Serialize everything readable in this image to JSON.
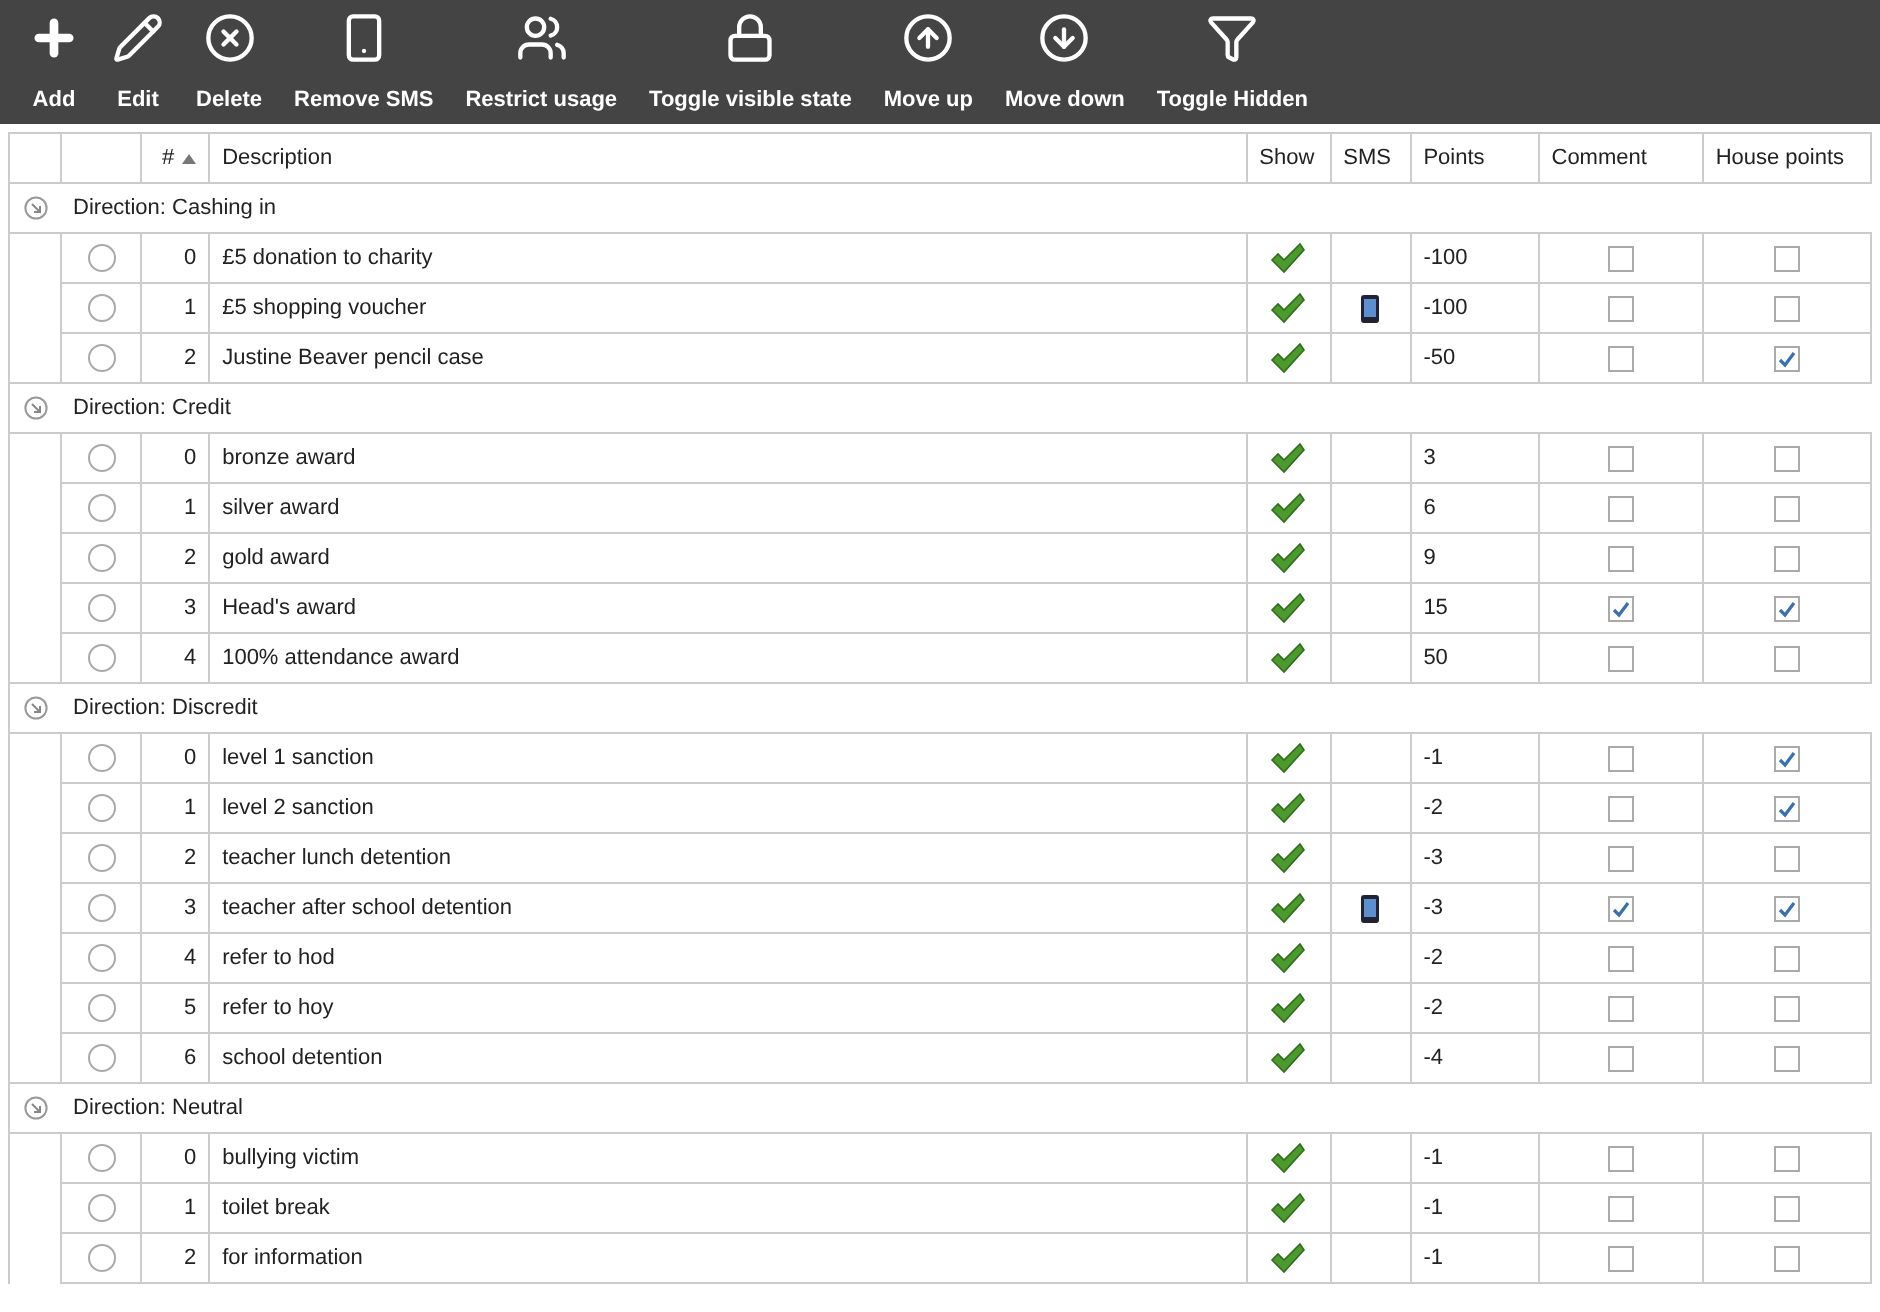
{
  "toolbar": [
    {
      "kind": "add",
      "label": "Add"
    },
    {
      "kind": "edit",
      "label": "Edit"
    },
    {
      "kind": "delete",
      "label": "Delete"
    },
    {
      "kind": "phone",
      "label": "Remove SMS"
    },
    {
      "kind": "users",
      "label": "Restrict usage"
    },
    {
      "kind": "lock",
      "label": "Toggle visible state"
    },
    {
      "kind": "up",
      "label": "Move up"
    },
    {
      "kind": "down",
      "label": "Move down"
    },
    {
      "kind": "funnel",
      "label": "Toggle Hidden"
    }
  ],
  "columns": [
    {
      "label": "#",
      "sorted": true,
      "ascending": true
    },
    {
      "label": "Description"
    },
    {
      "label": "Show"
    },
    {
      "label": "SMS"
    },
    {
      "label": "Points"
    },
    {
      "label": "Comment"
    },
    {
      "label": "House points"
    }
  ],
  "groups": [
    {
      "label": "Direction: Cashing in",
      "rows": [
        {
          "number": "0",
          "description": "£5 donation to charity",
          "selected": false,
          "show": true,
          "sms": false,
          "points": "-100",
          "comment": false,
          "house_points": false
        },
        {
          "number": "1",
          "description": "£5 shopping voucher",
          "selected": false,
          "show": true,
          "sms": true,
          "points": "-100",
          "comment": false,
          "house_points": false
        },
        {
          "number": "2",
          "description": "Justine Beaver pencil case",
          "selected": false,
          "show": true,
          "sms": false,
          "points": "-50",
          "comment": false,
          "house_points": true
        }
      ]
    },
    {
      "label": "Direction: Credit",
      "rows": [
        {
          "number": "0",
          "description": "bronze award",
          "selected": false,
          "show": true,
          "sms": false,
          "points": "3",
          "comment": false,
          "house_points": false
        },
        {
          "number": "1",
          "description": "silver award",
          "selected": false,
          "show": true,
          "sms": false,
          "points": "6",
          "comment": false,
          "house_points": false
        },
        {
          "number": "2",
          "description": "gold award",
          "selected": false,
          "show": true,
          "sms": false,
          "points": "9",
          "comment": false,
          "house_points": false
        },
        {
          "number": "3",
          "description": "Head's award",
          "selected": false,
          "show": true,
          "sms": false,
          "points": "15",
          "comment": true,
          "house_points": true
        },
        {
          "number": "4",
          "description": "100% attendance award",
          "selected": false,
          "show": true,
          "sms": false,
          "points": "50",
          "comment": false,
          "house_points": false
        }
      ]
    },
    {
      "label": "Direction: Discredit",
      "rows": [
        {
          "number": "0",
          "description": "level 1 sanction",
          "selected": false,
          "show": true,
          "sms": false,
          "points": "-1",
          "comment": false,
          "house_points": true
        },
        {
          "number": "1",
          "description": "level 2 sanction",
          "selected": false,
          "show": true,
          "sms": false,
          "points": "-2",
          "comment": false,
          "house_points": true
        },
        {
          "number": "2",
          "description": "teacher lunch detention",
          "selected": false,
          "show": true,
          "sms": false,
          "points": "-3",
          "comment": false,
          "house_points": false
        },
        {
          "number": "3",
          "description": "teacher after school detention",
          "selected": false,
          "show": true,
          "sms": true,
          "points": "-3",
          "comment": true,
          "house_points": true
        },
        {
          "number": "4",
          "description": "refer to hod",
          "selected": false,
          "show": true,
          "sms": false,
          "points": "-2",
          "comment": false,
          "house_points": false
        },
        {
          "number": "5",
          "description": "refer to hoy",
          "selected": false,
          "show": true,
          "sms": false,
          "points": "-2",
          "comment": false,
          "house_points": false
        },
        {
          "number": "6",
          "description": "school detention",
          "selected": false,
          "show": true,
          "sms": false,
          "points": "-4",
          "comment": false,
          "house_points": false
        }
      ]
    },
    {
      "label": "Direction: Neutral",
      "rows": [
        {
          "number": "0",
          "description": "bullying victim",
          "selected": false,
          "show": true,
          "sms": false,
          "points": "-1",
          "comment": false,
          "house_points": false
        },
        {
          "number": "1",
          "description": "toilet break",
          "selected": false,
          "show": true,
          "sms": false,
          "points": "-1",
          "comment": false,
          "house_points": false
        },
        {
          "number": "2",
          "description": "for information",
          "selected": false,
          "show": true,
          "sms": false,
          "points": "-1",
          "comment": false,
          "house_points": false
        }
      ]
    }
  ]
}
